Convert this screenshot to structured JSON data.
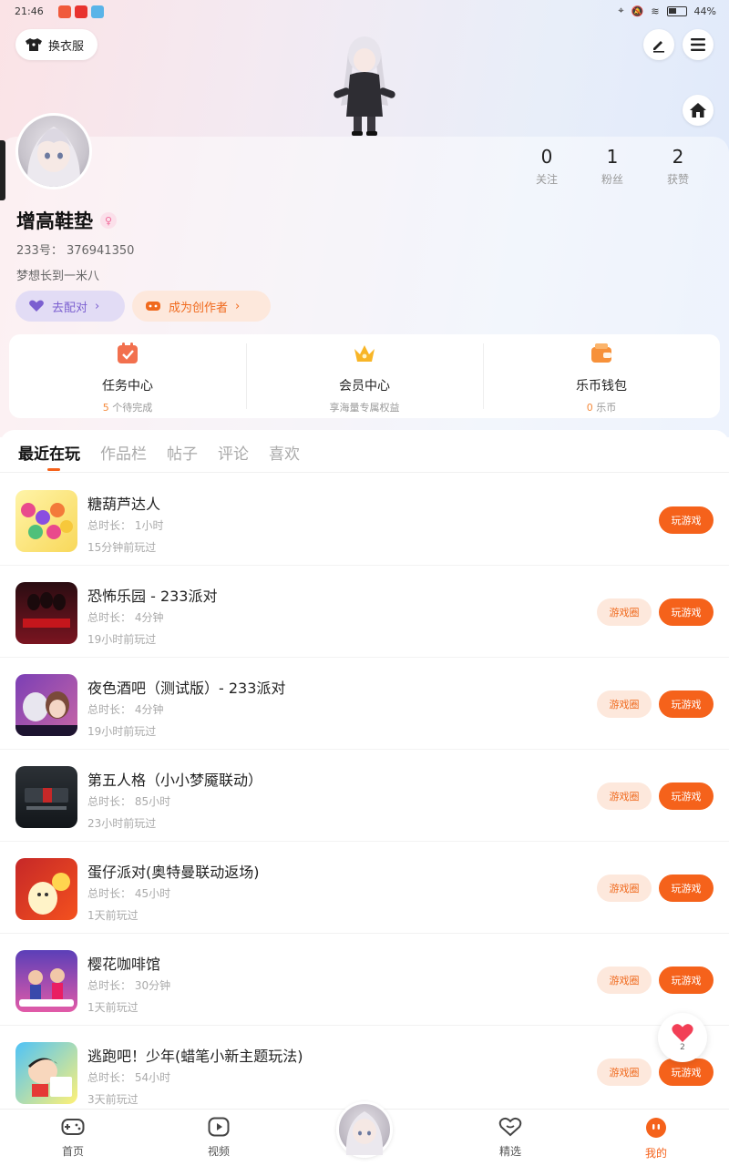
{
  "status_bar": {
    "time": "21:46",
    "battery": "44%"
  },
  "header": {
    "outfit_label": "换衣服"
  },
  "profile": {
    "stats": [
      {
        "value": "0",
        "label": "关注"
      },
      {
        "value": "1",
        "label": "粉丝"
      },
      {
        "value": "2",
        "label": "获赞"
      }
    ],
    "name": "增高鞋垫",
    "gender_symbol": "♀",
    "uid": "233号： 376941350",
    "bio": "梦想长到一米八",
    "match_label": "去配对",
    "creator_label": "成为创作者"
  },
  "quick_links": [
    {
      "title": "任务中心",
      "count": "5",
      "sub": "个待完成"
    },
    {
      "title": "会员中心",
      "count": "",
      "sub": "享海量专属权益"
    },
    {
      "title": "乐币钱包",
      "count": "0",
      "sub": "乐币"
    }
  ],
  "tabs": [
    "最近在玩",
    "作品栏",
    "帖子",
    "评论",
    "喜欢"
  ],
  "games": [
    {
      "title": "糖葫芦达人",
      "duration": "总时长： 1小时",
      "ago": "15分钟前玩过",
      "has_circle": false
    },
    {
      "title": "恐怖乐园 - 233派对",
      "duration": "总时长： 4分钟",
      "ago": "19小时前玩过",
      "has_circle": true
    },
    {
      "title": "夜色酒吧（测试版）- 233派对",
      "duration": "总时长： 4分钟",
      "ago": "19小时前玩过",
      "has_circle": true
    },
    {
      "title": "第五人格（小小梦魇联动）",
      "duration": "总时长： 85小时",
      "ago": "23小时前玩过",
      "has_circle": true
    },
    {
      "title": "蛋仔派对(奥特曼联动返场)",
      "duration": "总时长： 45小时",
      "ago": "1天前玩过",
      "has_circle": true
    },
    {
      "title": "樱花咖啡馆",
      "duration": "总时长： 30分钟",
      "ago": "1天前玩过",
      "has_circle": true
    },
    {
      "title": "逃跑吧！少年(蜡笔小新主题玩法)",
      "duration": "总时长： 54小时",
      "ago": "3天前玩过",
      "has_circle": true
    }
  ],
  "buttons": {
    "play": "玩游戏",
    "circle": "游戏圈"
  },
  "float_like_count": "2",
  "bottom_nav": [
    {
      "label": "首页"
    },
    {
      "label": "视频"
    },
    {
      "label": "精选"
    },
    {
      "label": "我的"
    }
  ],
  "colors": {
    "accent": "#f5621b",
    "accent_soft": "#fde8dc",
    "match_purple": "#7b5fd0"
  }
}
